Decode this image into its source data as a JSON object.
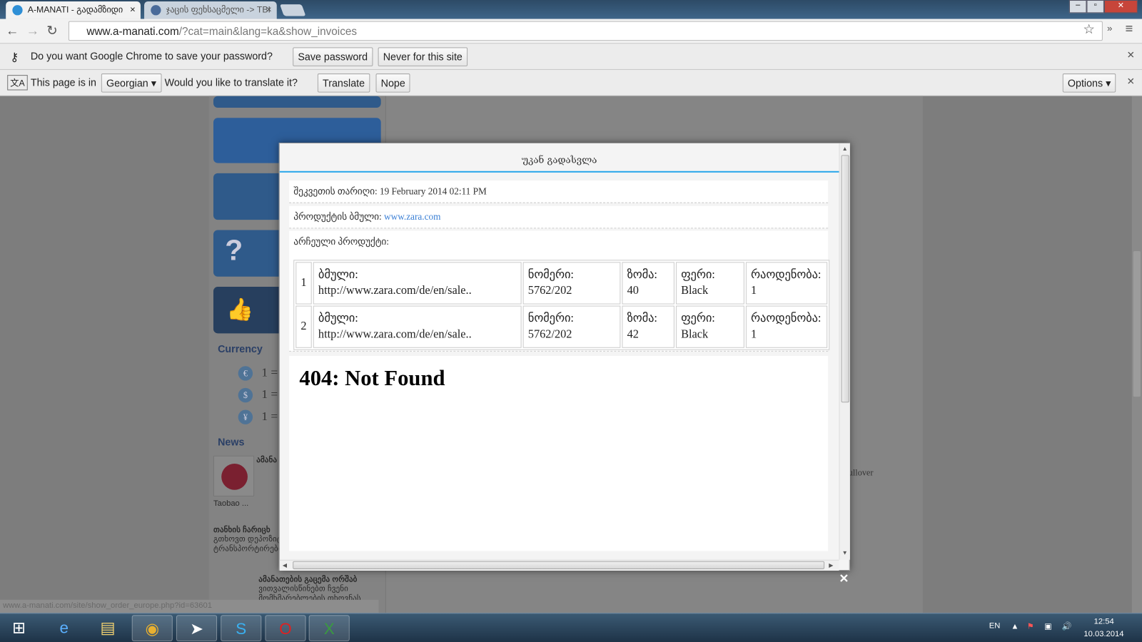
{
  "browser": {
    "tabs": [
      {
        "title": "A-MANATI - გადამზიდი",
        "active": true
      },
      {
        "title": "ჯაცის ფეხსაცმელი -> TBI",
        "active": false
      }
    ],
    "url_host": "www.a-manati.com",
    "url_rest": "/?cat=main&lang=ka&show_invoices",
    "password_bar": {
      "message": "Do you want Google Chrome to save your password?",
      "save": "Save password",
      "never": "Never for this site"
    },
    "translate_bar": {
      "prefix": "This page is in",
      "language": "Georgian",
      "question": "Would you like to translate it?",
      "translate": "Translate",
      "nope": "Nope",
      "options": "Options"
    },
    "status_url": "www.a-manati.com/site/show_order_europe.php?id=63601"
  },
  "sidebar": {
    "currency_title": "Currency",
    "currencies": [
      {
        "symbol": "€",
        "text": "1 ="
      },
      {
        "symbol": "$",
        "text": "1 ="
      },
      {
        "symbol": "¥",
        "text": "1 ="
      }
    ],
    "news_title": "News",
    "news": [
      {
        "title": "ამანა",
        "snippet": "Taobao ..."
      },
      {
        "title": "თანხის ჩარიცხ",
        "snippet": "გთხოვთ დეპოზიტი ინდით პროდუქციი ტრანსპორტირების"
      },
      {
        "title": "ამანათების გაცემა ორშაბ",
        "snippet": "ვითვალისწინებთ ჩვენი მომხმარებლების თხოვნას ევროპის"
      }
    ]
  },
  "modal": {
    "back": "უკან გადასვლა",
    "date_label": "შეკვეთის თარიღი:",
    "date": "19 February 2014 02:11 PM",
    "link_label": "პროდუქტის ბმული:",
    "link": "www.zara.com",
    "products_label": "არჩეული პროდუქტი:",
    "headers": {
      "link": "ბმული:",
      "number": "ნომერი:",
      "size": "ზომა:",
      "color": "ფერი:",
      "qty": "რაოდენობა:"
    },
    "items": [
      {
        "n": "1",
        "link": "http://www.zara.com/de/en/sale..",
        "number": "5762/202",
        "size": "40",
        "color": "Black",
        "qty": "1"
      },
      {
        "n": "2",
        "link": "http://www.zara.com/de/en/sale..",
        "number": "5762/202",
        "size": "42",
        "color": "Black",
        "qty": "1"
      }
    ],
    "error": "404: Not Found"
  },
  "background_text": "ullover",
  "taskbar": {
    "lang": "EN",
    "time": "12:54",
    "date": "10.03.2014"
  }
}
